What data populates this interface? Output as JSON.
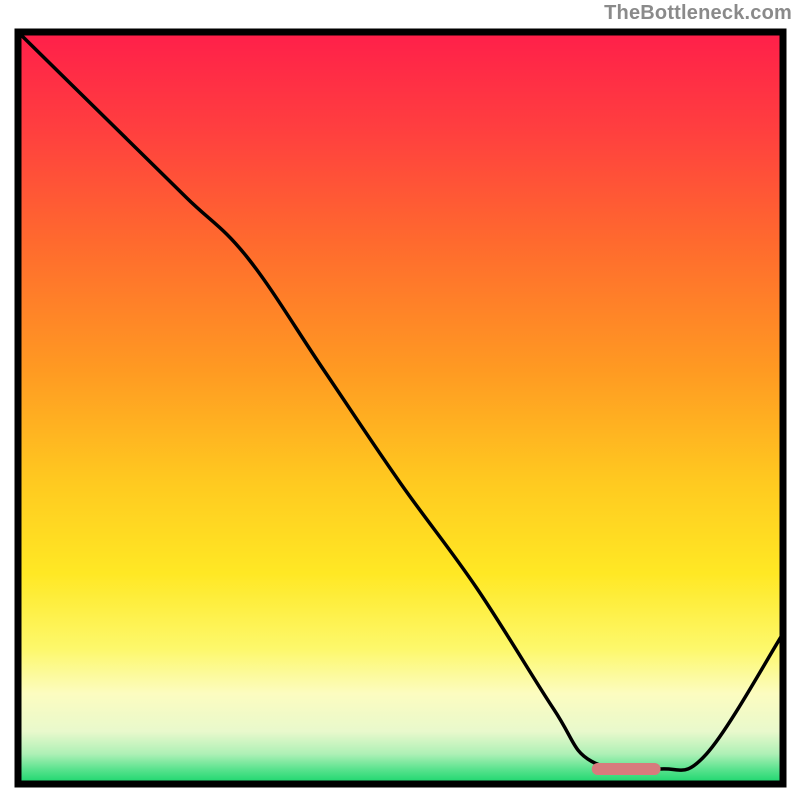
{
  "watermark": {
    "text": "TheBottleneck.com"
  },
  "chart_data": {
    "type": "line",
    "title": "",
    "xlabel": "",
    "ylabel": "",
    "xlim": [
      0,
      100
    ],
    "ylim": [
      0,
      100
    ],
    "gradient_stops": [
      {
        "offset": 0,
        "color": "#ff1f4a"
      },
      {
        "offset": 13,
        "color": "#ff3f3f"
      },
      {
        "offset": 28,
        "color": "#ff6a2e"
      },
      {
        "offset": 45,
        "color": "#ff9a22"
      },
      {
        "offset": 60,
        "color": "#ffca20"
      },
      {
        "offset": 72,
        "color": "#ffe824"
      },
      {
        "offset": 82,
        "color": "#fdf86b"
      },
      {
        "offset": 88,
        "color": "#fcfcc0"
      },
      {
        "offset": 93,
        "color": "#e9f9cc"
      },
      {
        "offset": 96,
        "color": "#aef0b6"
      },
      {
        "offset": 98,
        "color": "#5ce38f"
      },
      {
        "offset": 100,
        "color": "#15d56a"
      }
    ],
    "series": [
      {
        "name": "curve",
        "x": [
          0,
          12,
          22,
          30,
          40,
          50,
          60,
          70,
          75,
          84,
          90,
          100
        ],
        "values": [
          100,
          88,
          78,
          70,
          55,
          40,
          26,
          10,
          3,
          2,
          4,
          20
        ]
      }
    ],
    "marker": {
      "x_start": 75,
      "x_end": 84,
      "y": 2,
      "color": "#d77b7d"
    },
    "frame_color": "#000000",
    "line_color": "#000000"
  }
}
